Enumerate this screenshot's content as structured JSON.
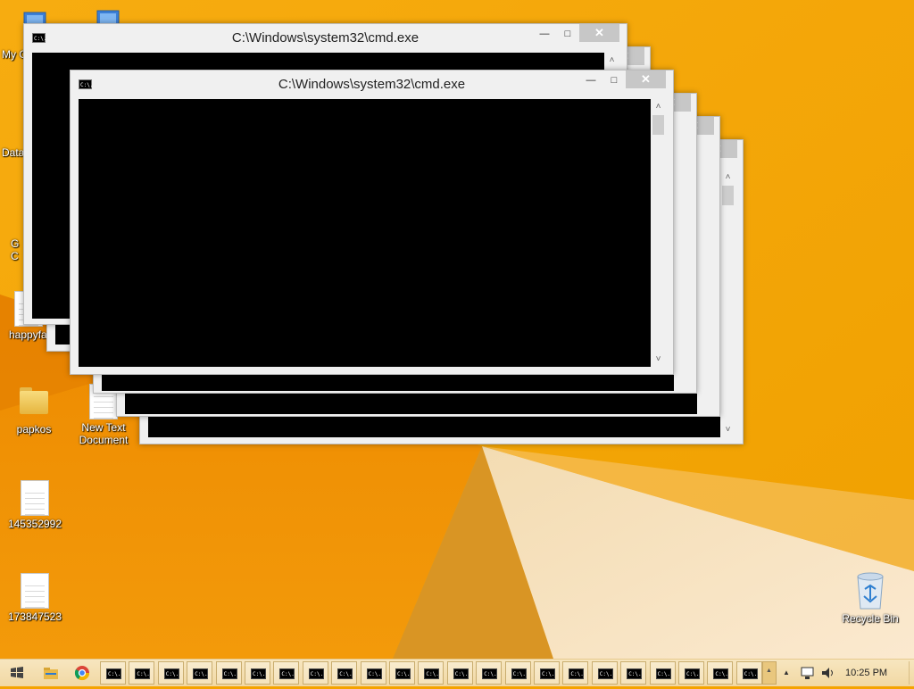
{
  "desktop": {
    "icons": [
      {
        "label": "My C",
        "icon": "computer-icon"
      },
      {
        "label": "Data",
        "icon": "shortcut-icon"
      },
      {
        "label": "G\nC",
        "icon": "chrome-shortcut-icon"
      },
      {
        "label": "happyfa",
        "icon": "file-icon"
      },
      {
        "label": "papkos",
        "icon": "folder-icon"
      },
      {
        "label": "New Text Document",
        "icon": "text-file-icon"
      },
      {
        "label": "145352992",
        "icon": "text-file-icon"
      },
      {
        "label": "173847523",
        "icon": "text-file-icon"
      },
      {
        "label": "Recycle Bin",
        "icon": "recycle-bin-icon"
      }
    ]
  },
  "windows": {
    "back_title": "C:\\Windows\\system32\\cmd.exe",
    "front_title": "C:\\Windows\\system32\\cmd.exe",
    "icon_text": "C:\\.",
    "minimize_glyph": "—",
    "maximize_glyph": "□",
    "close_glyph": "✕",
    "scroll_up_glyph": "˄",
    "scroll_down_glyph": "˅"
  },
  "taskbar": {
    "start_icon": "windows-logo-icon",
    "pinned": [
      "file-explorer-icon",
      "chrome-icon"
    ],
    "cmd_icon_text": "C:\\.",
    "cmd_count": 23,
    "tray_icons": [
      "show-hidden-icons-icon",
      "network-icon",
      "volume-icon"
    ],
    "clock": "10:25 PM",
    "overflow_arrow": "▲"
  },
  "colors": {
    "wallpaper_orange": "#f5a300",
    "taskbar": "#f3dcaa",
    "console": "#000000"
  }
}
